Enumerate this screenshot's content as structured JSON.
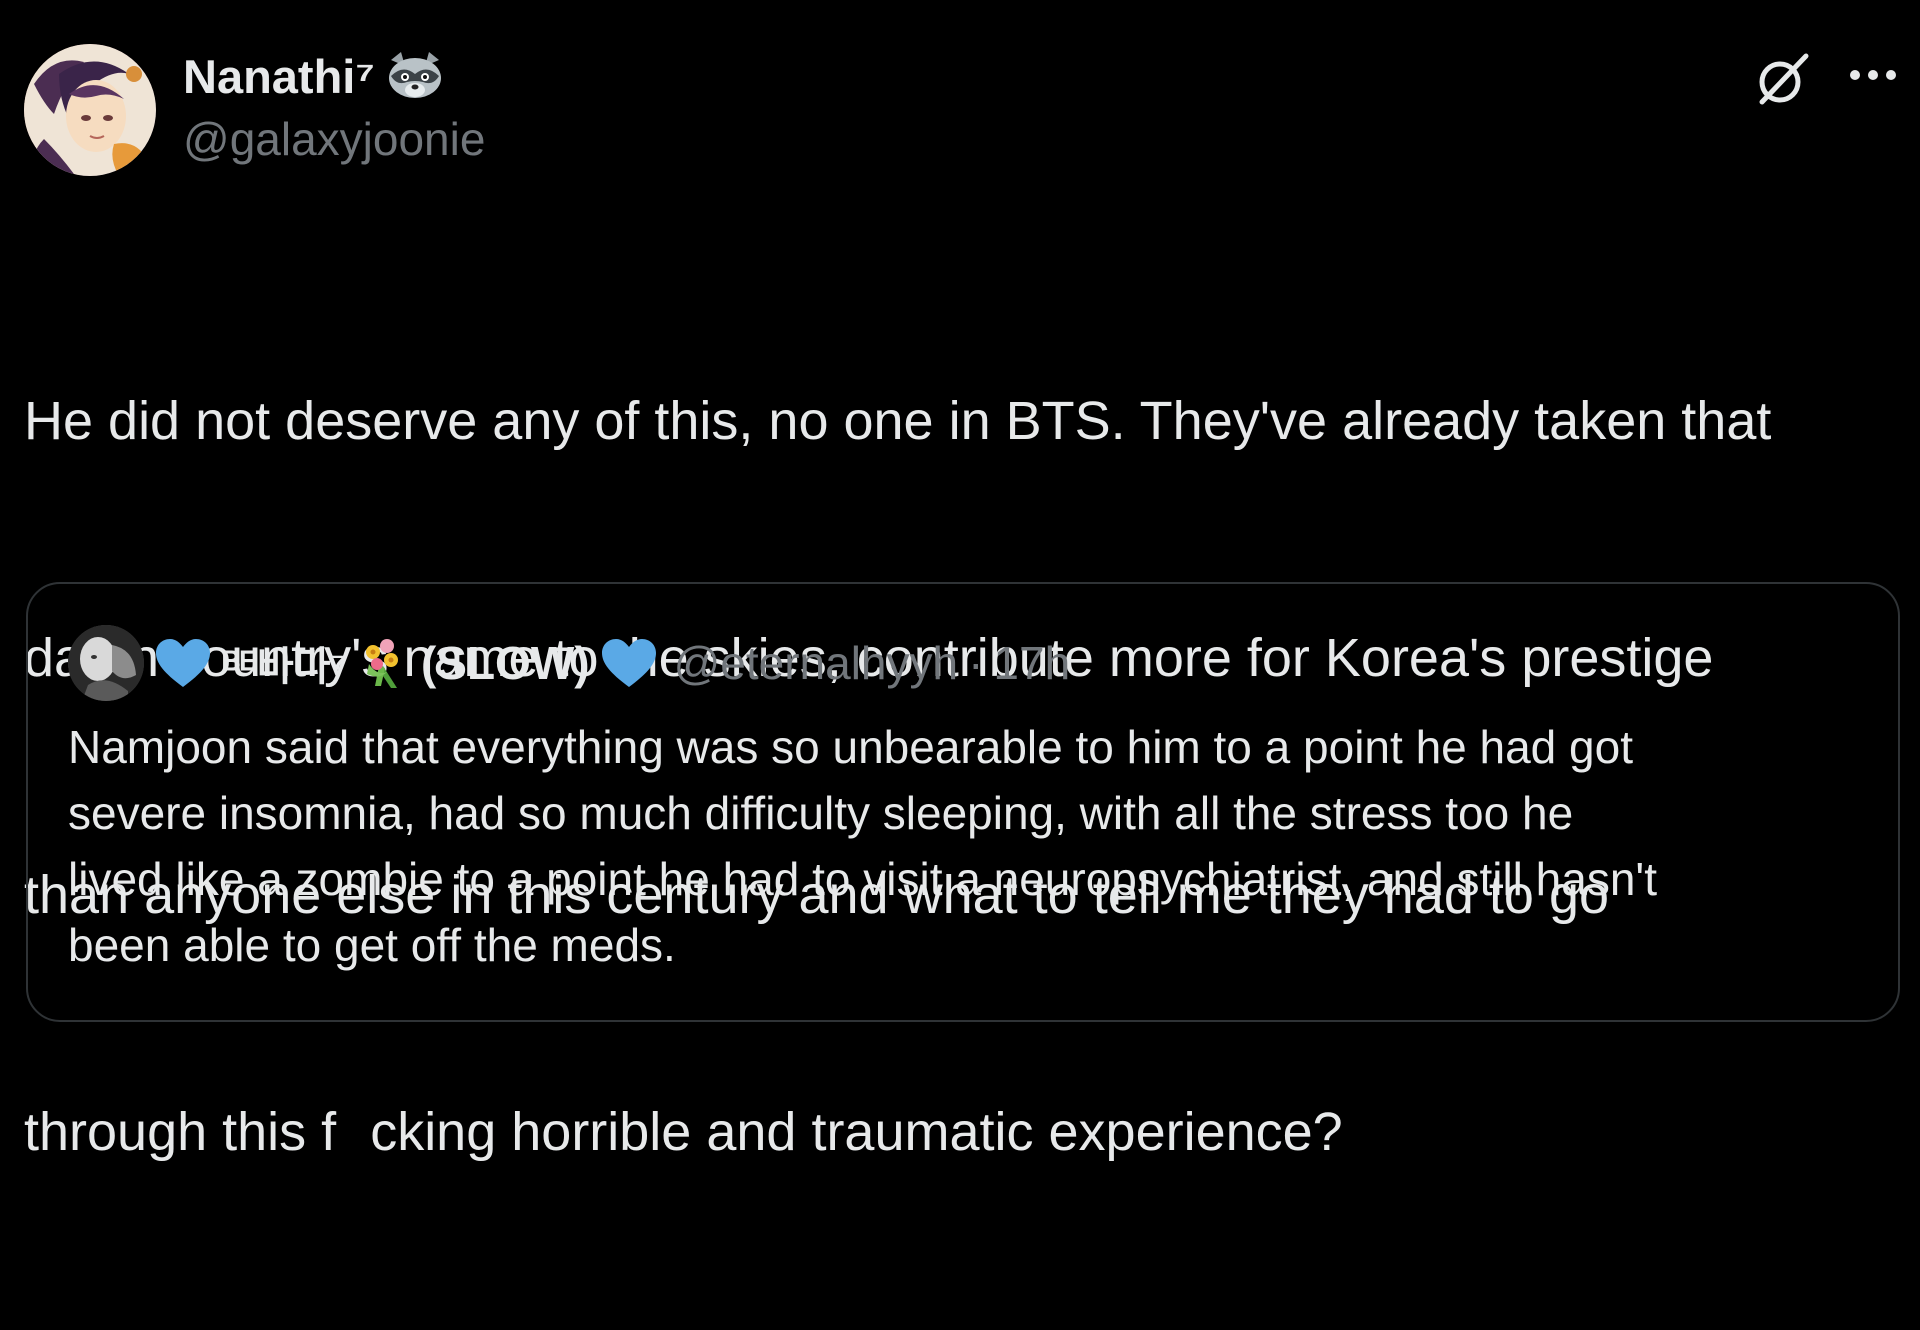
{
  "author": {
    "display_name": "Nanathi⁷",
    "handle": "@galaxyjoonie",
    "badge_icon": "raccoon-icon",
    "avatar_icon": "anime-avatar"
  },
  "actions": {
    "grok_icon": "grok-icon",
    "more_icon": "more-options-icon"
  },
  "tweet": {
    "lines": [
      "He did not deserve any of this, no one in BTS. They've already taken that",
      "damn country's name to the skies, contribute more for Korea's prestige",
      "than anyone else in this century and what to tell me they had to go"
    ],
    "last_line_before": "through this f",
    "last_line_after": "cking horrible and traumatic experience?"
  },
  "quote": {
    "name_part_a": "ᴮᴱ바다⁷",
    "name_part_b": "(SLOW)",
    "handle": "@eternalhyyh",
    "separator": "·",
    "time": "17h",
    "heart_color": "#5aa9e6",
    "lines": [
      "Namjoon said that everything was so unbearable to him to a point he had got",
      "severe insomnia, had so much difficulty sleeping, with all the stress too he",
      "lived like a zombie to a point he had to visit a neuropsychiatrist, and still hasn't",
      "been able to get off the meds."
    ]
  },
  "colors": {
    "background": "#000000",
    "text": "#e7e9ea",
    "secondary": "#71767b",
    "border": "#2f3336"
  }
}
